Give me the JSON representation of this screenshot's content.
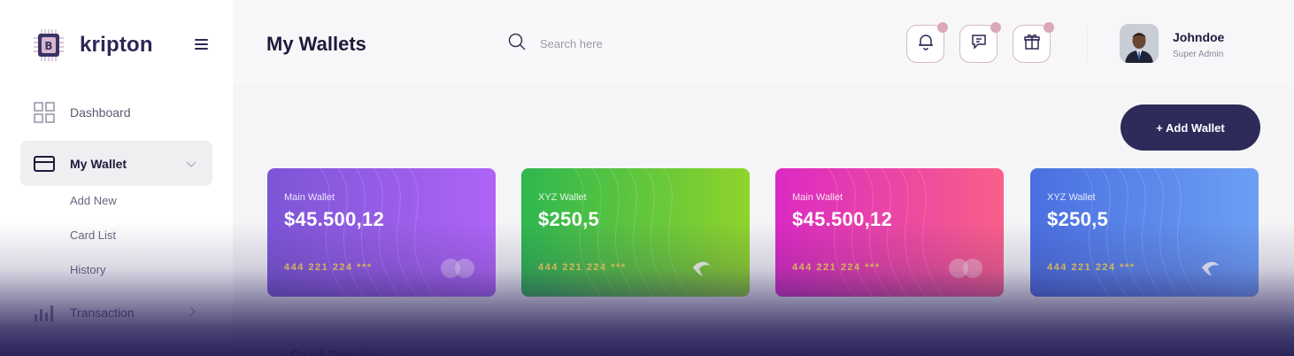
{
  "brand": {
    "name": "kripton"
  },
  "sidebar": {
    "items": [
      {
        "label": "Dashboard",
        "icon": "grid-icon"
      },
      {
        "label": "My Wallet",
        "icon": "wallet-card-icon",
        "active": true
      },
      {
        "label": "Transaction",
        "icon": "bar-chart-icon"
      }
    ],
    "sub_items": [
      "Add New",
      "Card List",
      "History"
    ]
  },
  "header": {
    "title": "My Wallets",
    "search_placeholder": "Search here",
    "icons": [
      "bell-icon",
      "message-icon",
      "gift-icon"
    ]
  },
  "user": {
    "name": "Johndoe",
    "role": "Super Admin"
  },
  "actions": {
    "add_wallet": "+ Add Wallet"
  },
  "cards": [
    {
      "type": "Main Wallet",
      "amount": "$45.500,12",
      "number": "444 221 224 ***",
      "brand_icon": "mastercard-icon"
    },
    {
      "type": "XYZ Wallet",
      "amount": "$250,5",
      "number": "444 221 224 ***",
      "brand_icon": "swoosh-logo-icon"
    },
    {
      "type": "Main Wallet",
      "amount": "$45.500,12",
      "number": "444 221 224 ***",
      "brand_icon": "mastercard-icon"
    },
    {
      "type": "XYZ Wallet",
      "amount": "$250,5",
      "number": "444 221 224 ***",
      "brand_icon": "swoosh-logo-icon"
    }
  ],
  "section": {
    "title": "Card Details"
  },
  "colors": {
    "primary": "#2e2a5a",
    "accent_dot": "#d9a9b8",
    "card_number": "#f7d358"
  }
}
